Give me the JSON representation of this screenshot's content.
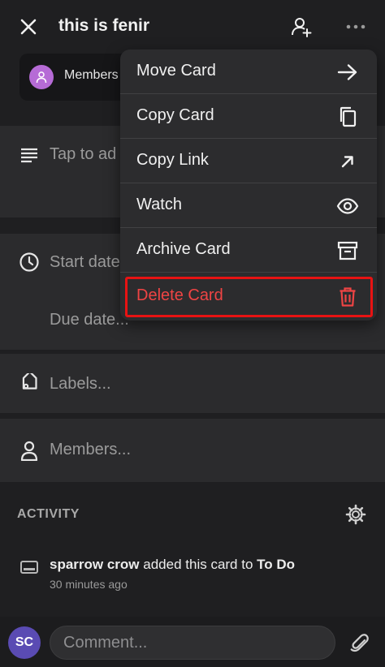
{
  "header": {
    "title": "this is fenir",
    "close_icon": "close-icon",
    "add_member_icon": "person-add-icon",
    "more_icon": "more-horizontal-icon"
  },
  "members_chip": {
    "label": "Members"
  },
  "description": {
    "placeholder": "Tap to ad"
  },
  "dates": {
    "start_placeholder": "Start date",
    "due_placeholder": "Due date..."
  },
  "labels": {
    "placeholder": "Labels..."
  },
  "members": {
    "placeholder": "Members..."
  },
  "activity": {
    "header": "ACTIVITY",
    "entries": [
      {
        "user": "sparrow crow",
        "action": " added this card to ",
        "target": "To Do",
        "time": "30 minutes ago"
      }
    ]
  },
  "comment": {
    "avatar_initials": "SC",
    "placeholder": "Comment..."
  },
  "menu": {
    "items": [
      {
        "label": "Move Card",
        "icon": "arrow-right-icon"
      },
      {
        "label": "Copy Card",
        "icon": "copy-icon"
      },
      {
        "label": "Copy Link",
        "icon": "arrow-up-right-icon"
      },
      {
        "label": "Watch",
        "icon": "eye-icon"
      },
      {
        "label": "Archive Card",
        "icon": "archive-icon"
      },
      {
        "label": "Delete Card",
        "icon": "trash-icon"
      }
    ]
  },
  "colors": {
    "background": "#1f1f21",
    "section": "#2b2b2d",
    "menu": "#2c2c2e",
    "danger": "#ef4444",
    "highlight": "#e81313",
    "avatar_member": "#b66bd6",
    "avatar_user": "#5a4bb3"
  }
}
